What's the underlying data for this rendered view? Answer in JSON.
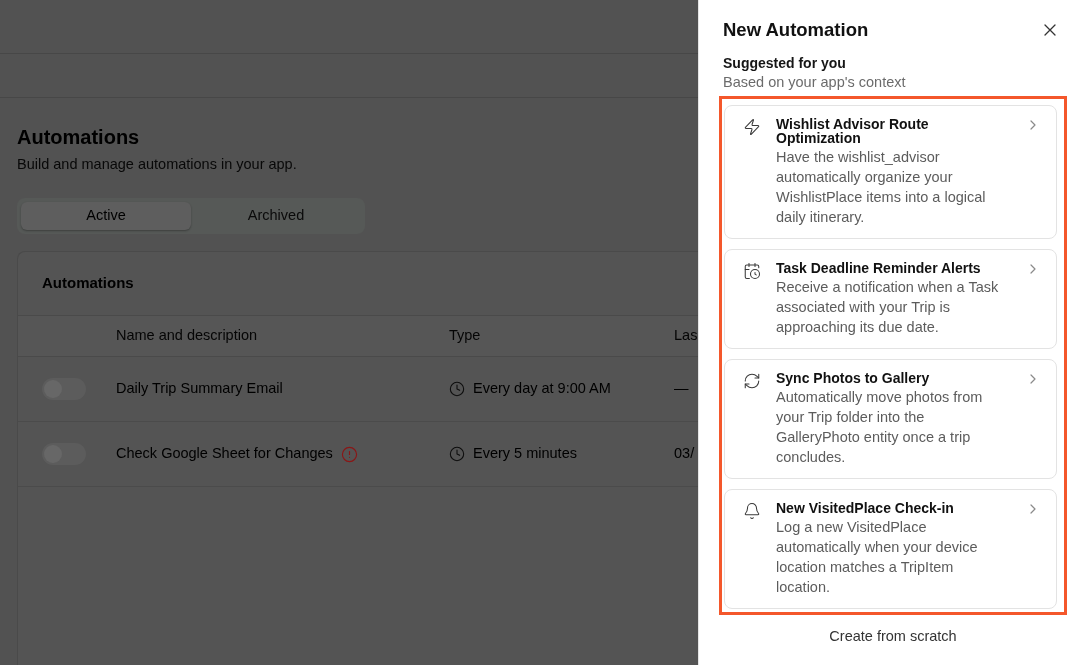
{
  "page": {
    "title": "Automations",
    "subtitle": "Build and manage automations in your app."
  },
  "tabs": [
    {
      "label": "Active",
      "selected": true
    },
    {
      "label": "Archived",
      "selected": false
    }
  ],
  "automations_card": {
    "title": "Automations",
    "columns": [
      "Name and description",
      "Type",
      "Las"
    ],
    "rows": [
      {
        "enabled": false,
        "name": "Daily Trip Summary Email",
        "warning": false,
        "type": "Every day at 9:00 AM",
        "column_3": "—"
      },
      {
        "enabled": false,
        "name": "Check Google Sheet for Changes",
        "warning": true,
        "type": "Every 5 minutes",
        "column_3": "03/"
      }
    ]
  },
  "panel": {
    "title": "New Automation",
    "section_title": "Suggested for you",
    "section_subtitle": "Based on your app's context",
    "highlighted": true,
    "suggestions": [
      {
        "kind": "bolt",
        "title": "Wishlist Advisor Route Optimization",
        "description": "Have the wishlist_advisor automatically organize your WishlistPlace items into a logical daily itinerary."
      },
      {
        "kind": "calendar",
        "title": "Task Deadline Reminder Alerts",
        "description": "Receive a notification when a Task associated with your Trip is approaching its due date."
      },
      {
        "kind": "sync",
        "title": "Sync Photos to Gallery",
        "description": "Automatically move photos from your Trip folder into the GalleryPhoto entity once a trip concludes."
      },
      {
        "kind": "bell",
        "title": "New VisitedPlace Check-in",
        "description": "Log a new VisitedPlace automatically when your device location matches a TripItem location."
      }
    ],
    "create_button": "Create from scratch"
  }
}
